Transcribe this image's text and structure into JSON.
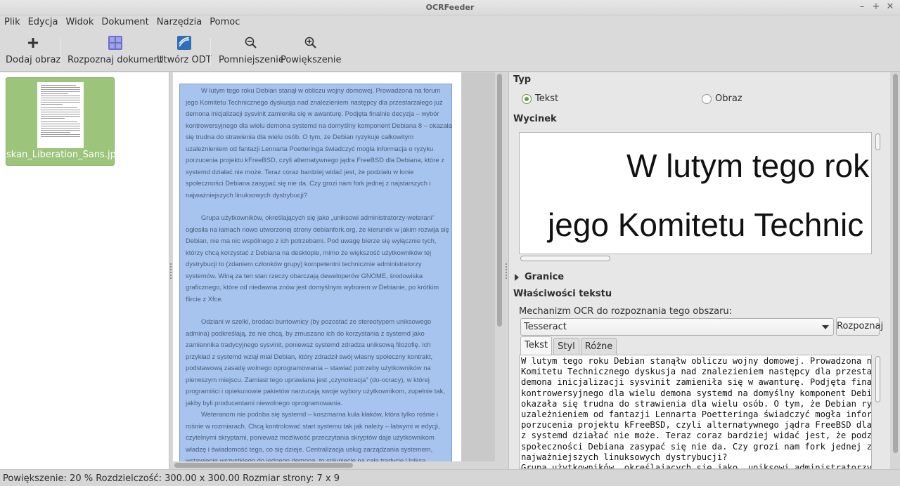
{
  "window": {
    "title": "OCRFeeder",
    "buttons": [
      "–",
      "+",
      "✕"
    ]
  },
  "menu": [
    "Plik",
    "Edycja",
    "Widok",
    "Dokument",
    "Narzędzia",
    "Pomoc"
  ],
  "toolbar": {
    "add_image": "Dodaj obraz",
    "recognize": "Rozpoznaj dokument",
    "create_odt": "Utwórz ODT",
    "zoom_out": "Pomniejszenie",
    "zoom_in": "Powiększenie"
  },
  "pages": [
    {
      "filename": "skan_Liberation_Sans.jpg"
    }
  ],
  "document": {
    "paragraphs": [
      "W lutym tego roku Debian stanął w obliczu wojny domowej. Prowadzona na forum jego Komitetu Technicznego dyskusja nad znalezieniem następcy dla przestarzałego już demona inicjalizacji sysvinit zamieniła się w awanturę. Podjęta finalnie decyzja – wybór kontrowersyjnego dla wielu demona systemd na domyślny komponent Debiana 8 – okazała się trudna do strawienia dla wielu osób. O tym, że Debian ryzykuje całkowitym uzależnieniem od fantazji Lennarta Poetteringa świadczyć mogła informacja o ryzyku porzucenia projektu kFreeBSD, czyli alternatywnego jądra FreeBSD dla Debiana, które z systemd działać nie może. Teraz coraz bardziej widać jest, że podziału w łonie społeczności Debiana zasypać się nie da. Czy grozi nam fork jednej z najstarszych i najważniejszych linuksowych dystrybucji?",
      "Grupa użytkowników, określających się jako „uniksowi administratorzy-weterani” ogłosiła na łamach nowo utworzonej strony debianfork.org, że kierunek w jakim rozwija się Debian, nie ma nic wspólnego z ich potrzebami. Pod uwagę bierze się wyłącznie tych, którzy chcą korzystać z Debiana na desktopie, mimo że większość użytkowników tej dystrybucji to (zdaniem członków grupy) kompetentni technicznie administratorzy systemów. Winą za ten stan rzeczy obarczają deweloperów GNOME, środowiska graficznego, które od niedawna znów jest domyślnym wyborem w Debianie, po krótkim flircie z Xfce.",
      "Odziani w szelki, brodaci buntownicy (by pozostać ze stereotypem uniksowego admina) podkreślają, że nie chcą, by zmuszano ich do korzystania z systemd jako zamiennika tradycyjnego sysvinit, ponieważ systemd zdradza uniksową filozofię. Ich przykład z systemd wziął miał Debian, który zdradził swój własny społeczny kontrakt, podstawową zasadę wolnego oprogramowania – stawiać potrzeby użytkowników na pierwszym miejscu. Zamiast tego uprawiana jest „czynokracja” (do-ocracy), w której programiści i opiekunowie pakietów narzucają swoje wybory użytkownikom, zupełnie tak, jakby byli producentami niewolnego oprogramowania.",
      "Weteranom nie podoba się systemd – koszmarna kula kłaków, która tylko rośnie i rośnie w rozmiarach. Chcą kontrolować start systemu tak jak należy – łatwymi w edycji, czytelnymi skryptami, ponieważ możliwość przeczytania skryptów daje użytkownikom władzę i świadomość tego, co się dzieje. Centralizacja usług zarządzania systemem, wstawienie wszystkiego do jednego demona, to splunięcie na całą tradycję Uniksa."
    ]
  },
  "properties": {
    "type_header": "Typ",
    "type_text": "Tekst",
    "type_image": "Obraz",
    "crop_header": "Wycinek",
    "crop_line1": "W lutym tego rok",
    "crop_line2": "jego Komitetu Technic",
    "bounds": "Granice",
    "text_props": "Właściwości tekstu",
    "ocr_engine_label": "Mechanizm OCR do rozpoznania tego obszaru:",
    "ocr_engine_value": "Tesseract",
    "recognize_btn": "Rozpoznaj",
    "tabs": [
      "Tekst",
      "Styl",
      "Różne"
    ],
    "text_lines": "W lutym tego roku Debian stanąłw obliczu wojny domowej. Prowadzona na forum jego\nKomitetu Technicznego dyskusja nad znalezieniem następcy dla przestarzałego już\ndemona inicjalizacji sysvinit zamieniła się w awanturę. Podjęta finalnie decyzja - wybór\nkontrowersyjnego dla wielu demona systemd na domyślny komponent Debiana 8\nokazała się trudna do strawienia dla wielu osób. O tym, że Debian ryzykuje całkowitym\nuzależnieniem od fantazji Lennarta Poetteringa świadczyć mogła informacja o ryzyku\nporzucenia projektu kFreeBSD, czyli alternatywnego jądra FreeBSD dla Debiana, które\nz systemd działać nie może. Teraz coraz bardziej widać jest, że podziału w łonie\nspołeczności Debiana zasypać się nie da. Czy grozi nam fork jednej z najstarszych i\nnajważniejszych linuksowych dystrybucji?\nGrupa użytkowników, określających się jako „uniksowi administratorzy-weterani”\nogłosiła na łamach nowo utworzonej strony debianfork.org, że kierunek w jakim rozwija"
  },
  "status": "Powiększenie: 20 % Rozdzielczość: 300.00 x 300.00 Rozmiar strony: 7 x 9"
}
